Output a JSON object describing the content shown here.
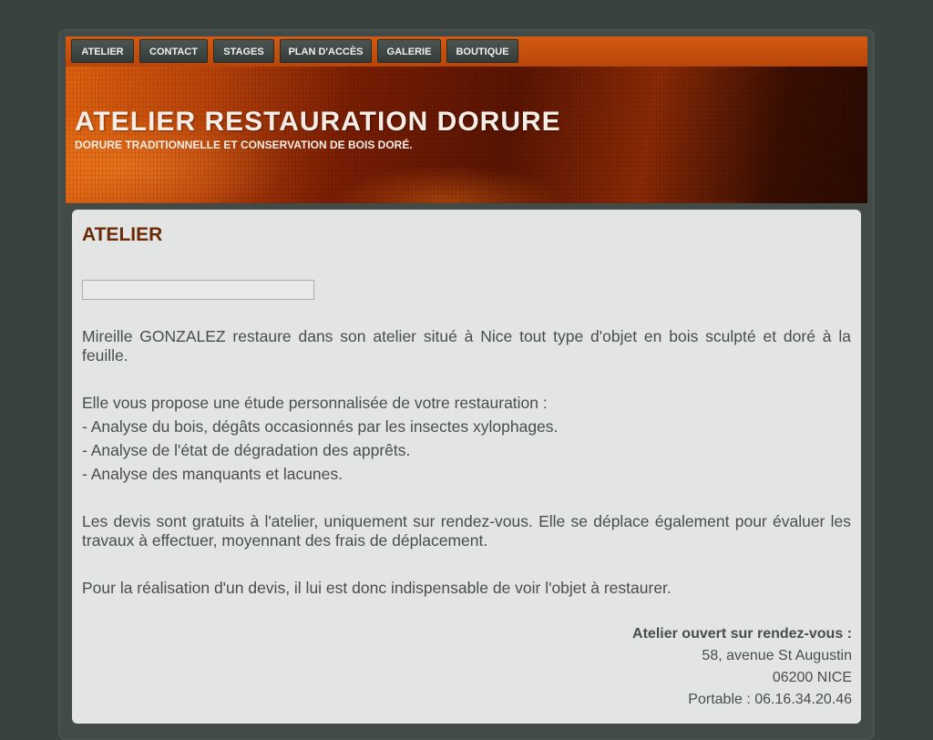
{
  "nav": {
    "items": [
      {
        "label": "ATELIER"
      },
      {
        "label": "CONTACT"
      },
      {
        "label": "STAGES"
      },
      {
        "label": "PLAN D'ACCÈS"
      },
      {
        "label": "GALERIE"
      },
      {
        "label": "BOUTIQUE"
      }
    ]
  },
  "header": {
    "title": "ATELIER RESTAURATION DORURE",
    "subtitle": "DORURE TRADITIONNELLE ET CONSERVATION DE BOIS DORÉ."
  },
  "main": {
    "title": "ATELIER",
    "intro": "Mireille GONZALEZ restaure dans son atelier situé à Nice tout type d'objet en bois sculpté et doré à la feuille.",
    "proposal": "Elle vous propose une étude personnalisée de votre restauration :",
    "list": [
      "- Analyse du bois, dégâts occasionnés par les insectes xylophages.",
      "- Analyse de l'état de dégradation des apprêts.",
      "- Analyse des manquants et lacunes."
    ],
    "quotes": "Les devis sont gratuits à l'atelier, uniquement sur rendez-vous. Elle se déplace également pour évaluer les travaux à effectuer, moyennant des frais de déplacement.",
    "requirement": "Pour la réalisation d'un devis, il lui est donc indispensable de voir l'objet à restaurer."
  },
  "address": {
    "heading": "Atelier ouvert sur rendez-vous :",
    "street": "58, avenue St Augustin",
    "city": "06200 NICE",
    "phone": "Portable : 06.16.34.20.46"
  },
  "colors": {
    "nav_bar": "#c84f0c",
    "nav_button": "#414947",
    "title_brown": "#6b2a06",
    "text": "#474f4d",
    "content_bg": "#e2e5e4",
    "page_bg": "#3a4240"
  }
}
